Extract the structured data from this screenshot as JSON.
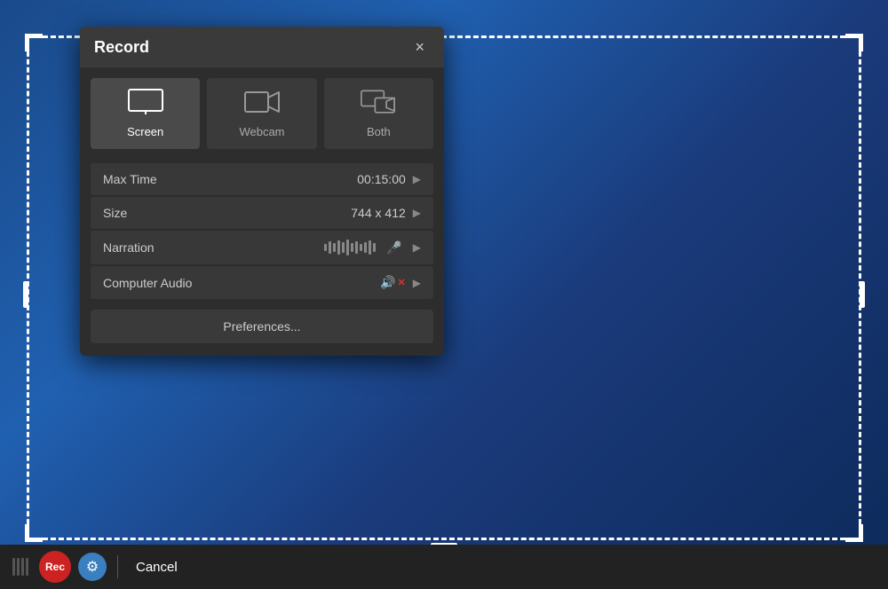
{
  "background": {
    "color_start": "#1a4a8a",
    "color_end": "#0d2a5a"
  },
  "dialog": {
    "title": "Record",
    "close_label": "×",
    "modes": [
      {
        "id": "screen",
        "label": "Screen",
        "active": true
      },
      {
        "id": "webcam",
        "label": "Webcam",
        "active": false
      },
      {
        "id": "both",
        "label": "Both",
        "active": false
      }
    ],
    "settings": [
      {
        "id": "max-time",
        "label": "Max Time",
        "value": "00:15:00",
        "type": "time"
      },
      {
        "id": "size",
        "label": "Size",
        "value": "744 x 412",
        "type": "size"
      },
      {
        "id": "narration",
        "label": "Narration",
        "value": "",
        "type": "narration"
      },
      {
        "id": "computer-audio",
        "label": "Computer Audio",
        "value": "",
        "type": "audio"
      }
    ],
    "preferences_label": "Preferences..."
  },
  "toolbar": {
    "rec_label": "Rec",
    "cancel_label": "Cancel"
  }
}
